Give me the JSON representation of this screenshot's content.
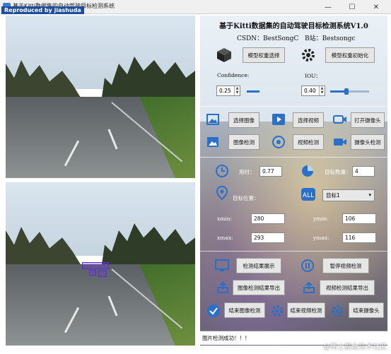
{
  "window": {
    "title": "基于Kitti数据集的自动驾驶目标检测系统",
    "overlay_tag": "Reproduced by jiashuda",
    "minimize": "—",
    "maximize": "☐",
    "close": "✕"
  },
  "header": {
    "title": "基于Kitti数据集的自动驾驶目标检测系统V1.0",
    "csdn": "CSDN：BestSongC",
    "bzhan": "B站：Bestsongc"
  },
  "model": {
    "select_label": "模型权重选择",
    "init_label": "模型权重初始化"
  },
  "params": {
    "confidence_label": "Confidence:",
    "confidence_value": "0.25",
    "iou_label": "IOU：",
    "iou_value": "0.40"
  },
  "actions": {
    "select_image": "选择图像",
    "select_video": "选择视频",
    "open_camera": "打开摄像头",
    "image_detect": "图像检测",
    "video_detect": "视频检测",
    "camera_detect": "摄像头检测"
  },
  "stats": {
    "time_label": "用时：",
    "time_value": "0.77",
    "count_label": "目标数量：",
    "count_value": "4",
    "position_label": "目标位置：",
    "target_select": "目标1",
    "xmin_label": "xmin:",
    "xmin_value": "280",
    "ymin_label": "ymin:",
    "ymin_value": "106",
    "xmax_label": "xmax:",
    "xmax_value": "293",
    "ymax_label": "ymax:",
    "ymax_value": "116"
  },
  "bottom": {
    "show_result": "检测结果展示",
    "pause_video": "暂停视频检测",
    "export_image": "图像检测结果导出",
    "export_video": "视频检测结果导出",
    "end_image": "结束图像检测",
    "end_video": "结束视频检测",
    "end_camera": "结束摄像头"
  },
  "status": {
    "message": "图片检测成功！！！"
  },
  "corner_watermark": "@稀土掘金技术社区",
  "colors": {
    "accent_blue": "#2a6fc9",
    "detect_purple": "#6e3ce6"
  }
}
